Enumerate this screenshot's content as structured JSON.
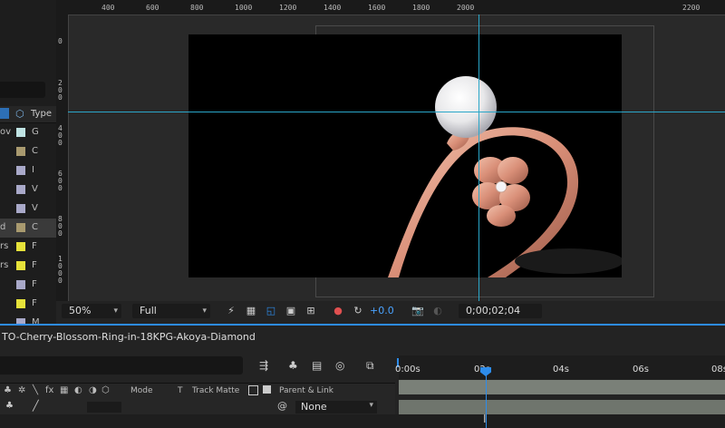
{
  "viewer": {
    "ruler_top": [
      "400",
      "600",
      "800",
      "1000",
      "1200",
      "1400",
      "1600",
      "1800",
      "2000",
      "2200"
    ],
    "ruler_left": [
      "0",
      "2\n0\n0",
      "4\n0\n0",
      "6\n0\n0",
      "8\n0\n0",
      "1\n0\n0\n0"
    ],
    "zoom": "50%",
    "resolution": "Full",
    "exposure": "+0.0",
    "timecode": "0;00;02;04"
  },
  "project": {
    "col_type": "Type",
    "rows": [
      {
        "lbl": "ov",
        "color": "#bfe3e3",
        "ic": "G"
      },
      {
        "lbl": "",
        "color": "#a99a6f",
        "ic": "C"
      },
      {
        "lbl": "",
        "color": "#a9a9c9",
        "ic": "I"
      },
      {
        "lbl": "",
        "color": "#a9a9c9",
        "ic": "V"
      },
      {
        "lbl": "",
        "color": "#a9a9c9",
        "ic": "V"
      },
      {
        "lbl": "d",
        "color": "#a99a6f",
        "ic": "C"
      },
      {
        "lbl": "rs",
        "color": "#e6e23a",
        "ic": "F"
      },
      {
        "lbl": "rs",
        "color": "#e6e23a",
        "ic": "F"
      },
      {
        "lbl": "",
        "color": "#a9a9c9",
        "ic": "F"
      },
      {
        "lbl": "",
        "color": "#e6e23a",
        "ic": "F"
      },
      {
        "lbl": "",
        "color": "#a9a9c9",
        "ic": "M"
      }
    ]
  },
  "timeline": {
    "comp_name": "TO-Cherry-Blossom-Ring-in-18KPG-Akoya-Diamond",
    "time_labels": [
      "0:00s",
      "02s",
      "04s",
      "06s",
      "08s"
    ],
    "col_mode": "Mode",
    "col_t": "T",
    "col_track_matte": "Track Matte",
    "col_parent": "Parent & Link",
    "parent_value": "None"
  },
  "colors": {
    "accent": "#2d8ceb",
    "guide": "#2aa7c9"
  }
}
